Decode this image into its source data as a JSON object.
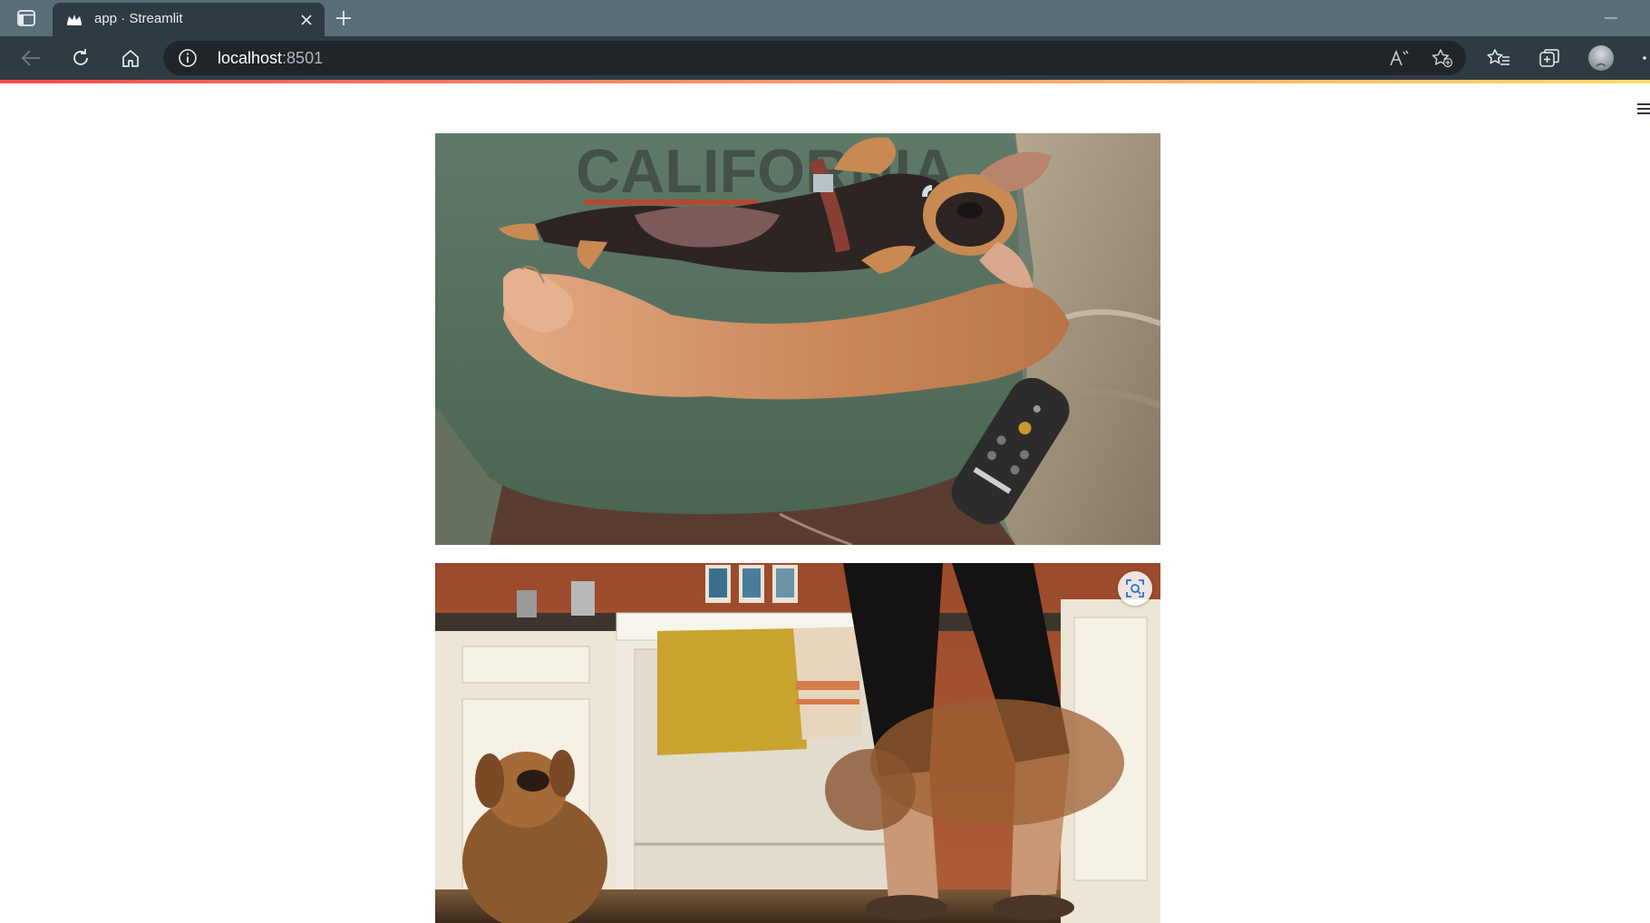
{
  "browser": {
    "tab": {
      "title": "app · Streamlit",
      "favicon": "streamlit-crown-icon"
    },
    "url": {
      "host": "localhost",
      "port": ":8501"
    },
    "icons": {
      "tab_actions": "tab-actions-icon",
      "close": "close-icon",
      "new_tab": "plus-icon",
      "back": "back-arrow-icon",
      "refresh": "refresh-icon",
      "home": "home-icon",
      "site_info": "info-icon",
      "read_aloud": "read-aloud-icon",
      "add_favorite": "star-plus-icon",
      "favorites": "favorites-icon",
      "collections": "collections-icon",
      "profile": "avatar",
      "more": "more-icon"
    },
    "accent_colors": [
      "#ff4b4b",
      "#ffd966"
    ]
  },
  "page": {
    "menu_icon": "hamburger-menu-icon",
    "images": [
      {
        "name": "puppy-on-arm-photo",
        "subject": "small dog lying on its back on a person's arm"
      },
      {
        "name": "kitchen-dogs-photo",
        "subject": "two dogs in a kitchen near a person's legs"
      }
    ],
    "image_overlay_icon": "visual-search-icon"
  }
}
